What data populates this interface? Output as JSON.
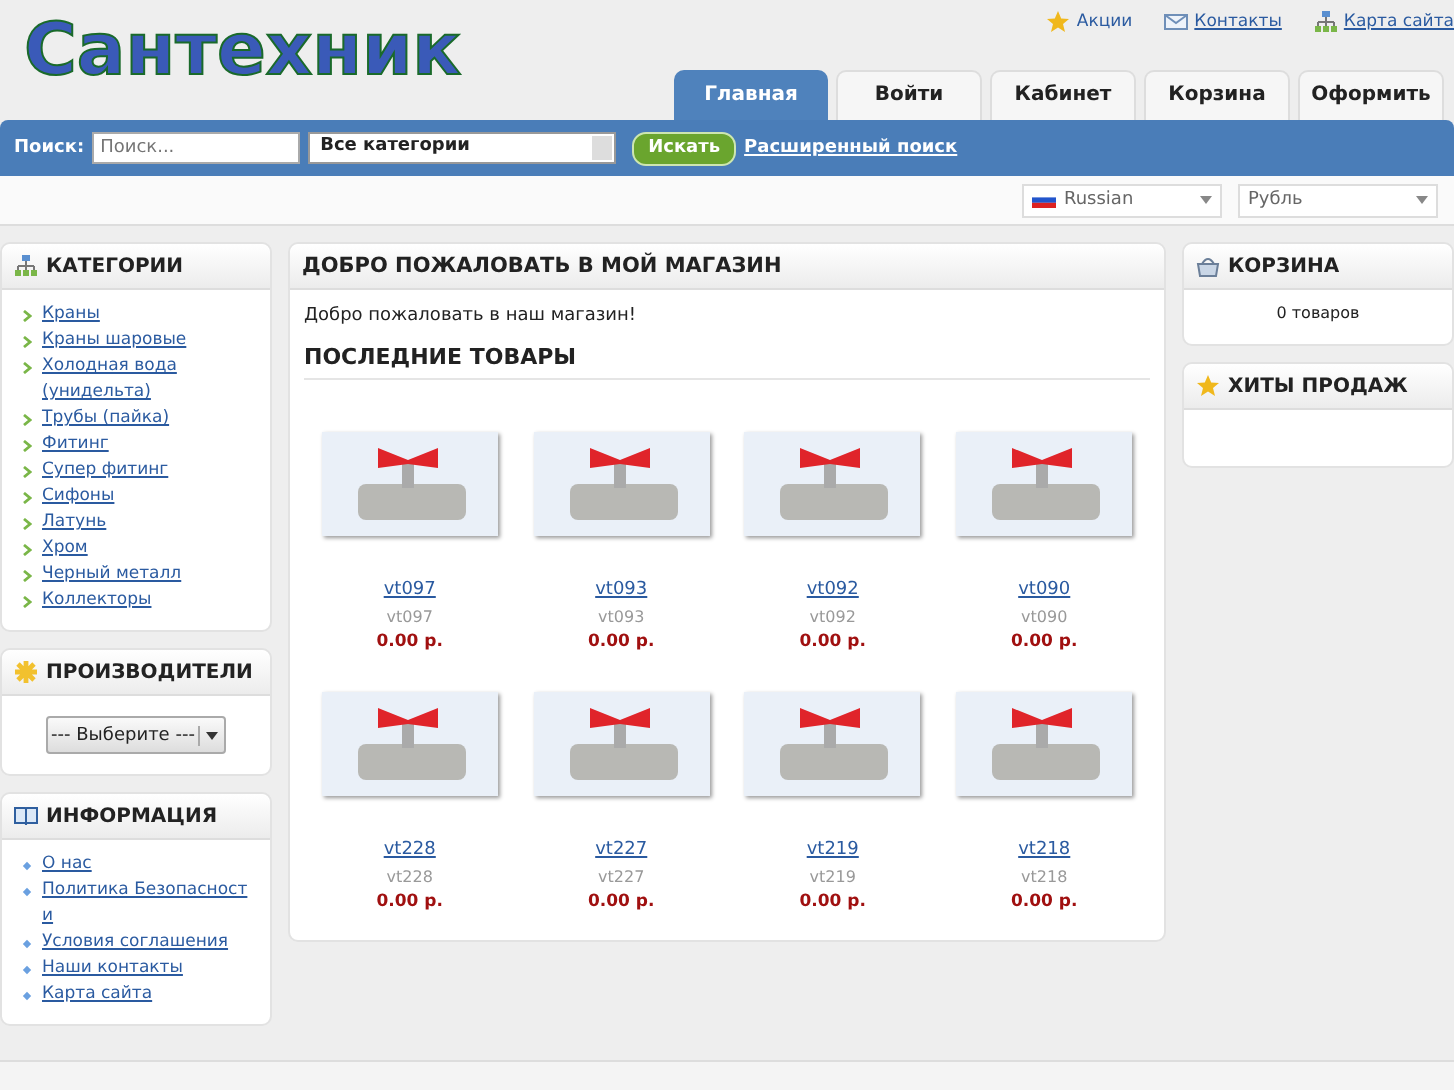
{
  "logo": "Сантехник",
  "top_links": [
    {
      "label": "Акции"
    },
    {
      "label": "Контакты"
    },
    {
      "label": "Карта сайта"
    }
  ],
  "tabs": [
    {
      "label": "Главная",
      "selected": true
    },
    {
      "label": "Войти",
      "selected": false
    },
    {
      "label": "Кабинет",
      "selected": false
    },
    {
      "label": "Корзина",
      "selected": false
    },
    {
      "label": "Оформить",
      "selected": false
    }
  ],
  "search": {
    "label": "Поиск:",
    "placeholder": "Поиск...",
    "category": "Все категории",
    "button": "Искать",
    "advanced": "Расширенный поиск"
  },
  "language": "Russian",
  "currency": "Рубль",
  "categories": {
    "title": "КАТЕГОРИИ",
    "items": [
      "Краны",
      "Краны шаровые",
      "Холодная вода (унидельта)",
      "Трубы (пайка)",
      "Фитинг",
      "Супер фитинг",
      "Сифоны",
      "Латунь",
      "Хром",
      "Черный металл",
      "Коллекторы"
    ]
  },
  "manufacturers": {
    "title": "ПРОИЗВОДИТЕЛИ",
    "select": "--- Выберите ---"
  },
  "information": {
    "title": "ИНФОРМАЦИЯ",
    "items": [
      "О нас",
      "Политика Безопасност и",
      "Условия соглашения",
      "Наши контакты",
      "Карта сайта"
    ]
  },
  "welcome": {
    "title": "ДОБРО ПОЖАЛОВАТЬ В МОЙ МАГАЗИН",
    "text": "Добро пожаловать в наш магазин!"
  },
  "latest": {
    "title": "ПОСЛЕДНИЕ ТОВАРЫ",
    "products": [
      {
        "name": "vt097",
        "model": "vt097",
        "price": "0.00 р."
      },
      {
        "name": "vt093",
        "model": "vt093",
        "price": "0.00 р."
      },
      {
        "name": "vt092",
        "model": "vt092",
        "price": "0.00 р."
      },
      {
        "name": "vt090",
        "model": "vt090",
        "price": "0.00 р."
      },
      {
        "name": "vt228",
        "model": "vt228",
        "price": "0.00 р."
      },
      {
        "name": "vt227",
        "model": "vt227",
        "price": "0.00 р."
      },
      {
        "name": "vt219",
        "model": "vt219",
        "price": "0.00 р."
      },
      {
        "name": "vt218",
        "model": "vt218",
        "price": "0.00 р."
      }
    ]
  },
  "cart": {
    "title": "КОРЗИНА",
    "text": "0 товаров"
  },
  "bestsellers": {
    "title": "ХИТЫ ПРОДАЖ"
  }
}
